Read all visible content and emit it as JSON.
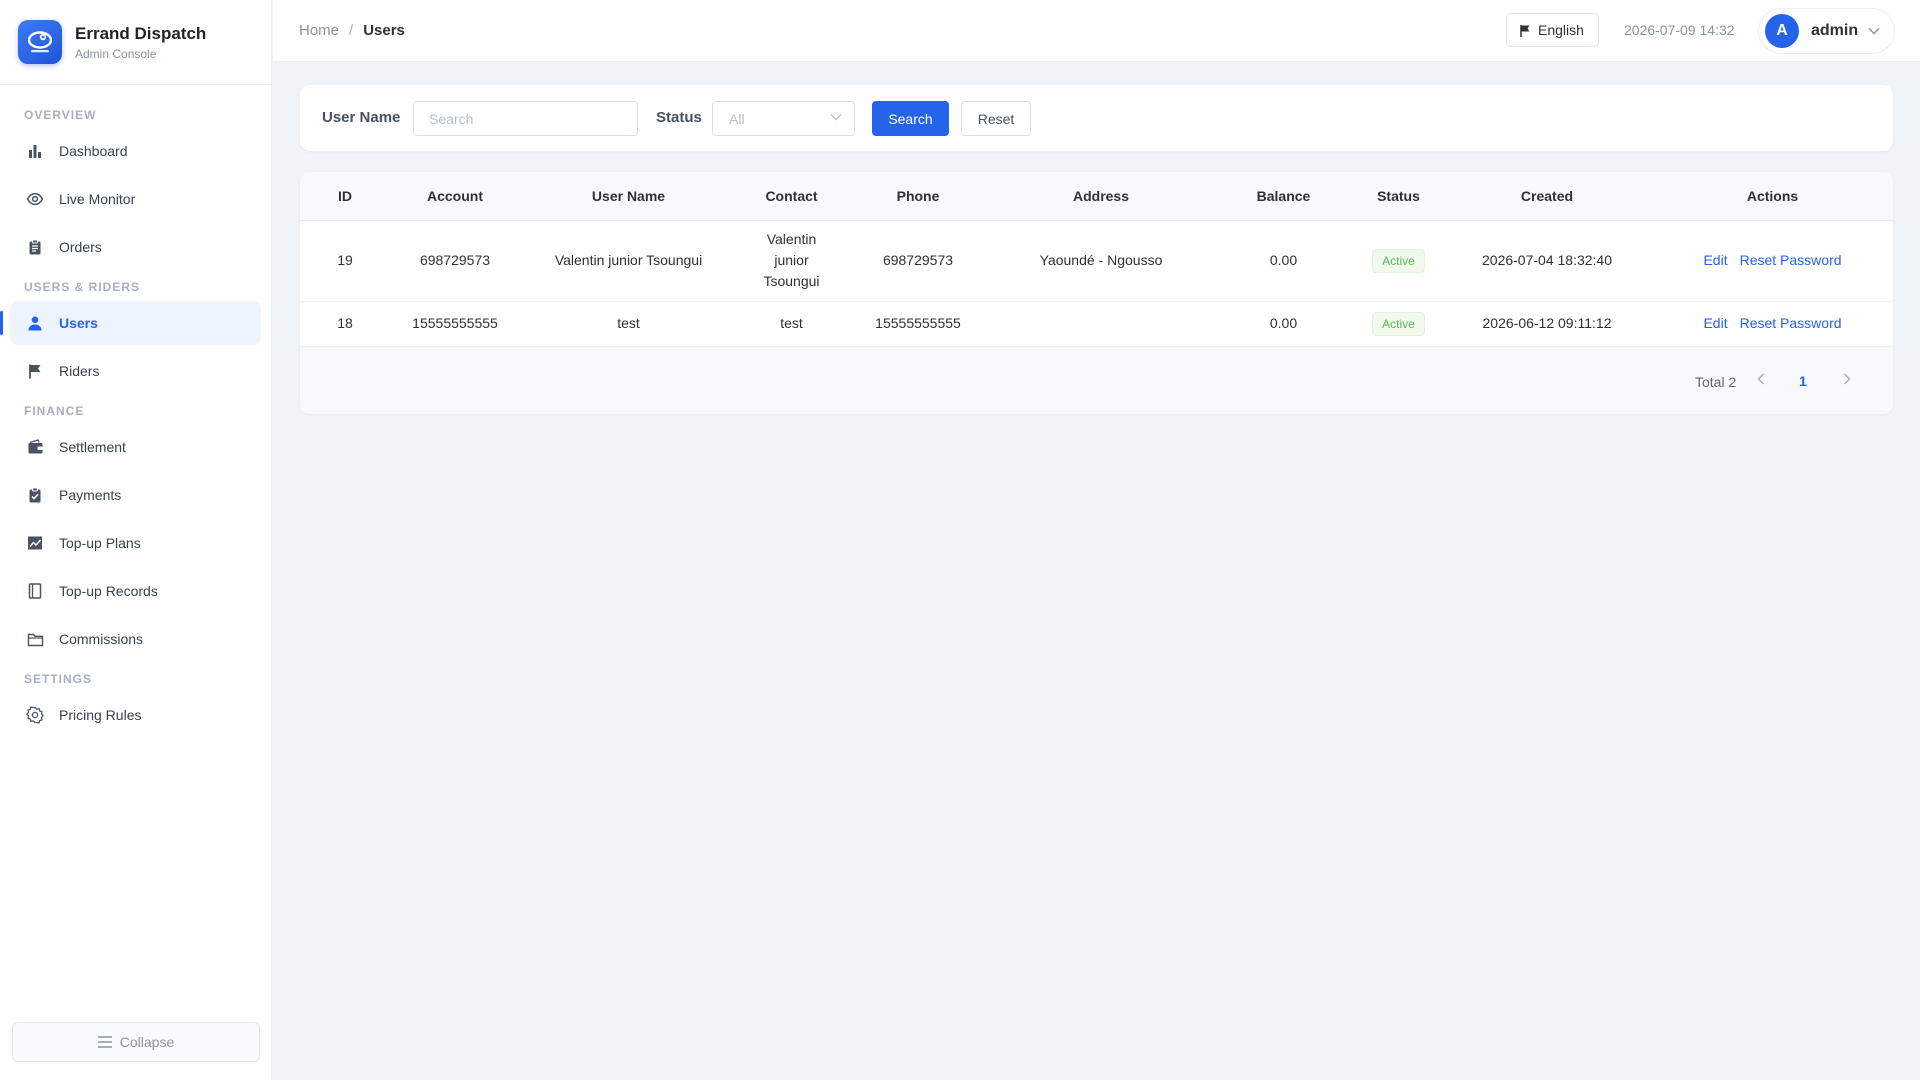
{
  "app": {
    "title": "Errand Dispatch",
    "subtitle": "Admin Console",
    "accent_color": "#2563eb"
  },
  "sidebar": {
    "groups": [
      {
        "label": "OVERVIEW",
        "items": [
          {
            "label": "Dashboard",
            "icon": "bar-chart-icon"
          },
          {
            "label": "Live Monitor",
            "icon": "eye-icon"
          },
          {
            "label": "Orders",
            "icon": "clipboard-icon"
          }
        ]
      },
      {
        "label": "USERS & RIDERS",
        "items": [
          {
            "label": "Users",
            "icon": "user-icon",
            "active": true
          },
          {
            "label": "Riders",
            "icon": "flag-icon"
          }
        ]
      },
      {
        "label": "FINANCE",
        "items": [
          {
            "label": "Settlement",
            "icon": "wallet-icon"
          },
          {
            "label": "Payments",
            "icon": "clipboard-check-icon"
          },
          {
            "label": "Top-up Plans",
            "icon": "trend-chart-icon"
          },
          {
            "label": "Top-up Records",
            "icon": "notebook-icon"
          },
          {
            "label": "Commissions",
            "icon": "folder-icon"
          }
        ]
      },
      {
        "label": "SETTINGS",
        "items": [
          {
            "label": "Pricing Rules",
            "icon": "gear-icon"
          }
        ]
      }
    ],
    "collapse_label": "Collapse"
  },
  "header": {
    "breadcrumb": [
      "Home",
      "Users"
    ],
    "breadcrumb_sep": "/",
    "language": "English",
    "datetime": "2026-07-09 14:32",
    "user": {
      "initial": "A",
      "name": "admin"
    }
  },
  "filters": {
    "username_label": "User Name",
    "username_value": "",
    "username_placeholder": "Search",
    "status_label": "Status",
    "status_selected": "All",
    "search_label": "Search",
    "reset_label": "Reset"
  },
  "table": {
    "columns": [
      "ID",
      "Account",
      "User Name",
      "Contact",
      "Phone",
      "Address",
      "Balance",
      "Status",
      "Created",
      "Actions"
    ],
    "rows": [
      {
        "id": "19",
        "account": "698729573",
        "user_name": "Valentin junior Tsoungui",
        "contact": "Valentin junior Tsoungui",
        "phone": "698729573",
        "address": "Yaoundé - Ngousso",
        "balance": "0.00",
        "status": "Active",
        "created": "2026-07-04 18:32:40",
        "actions": [
          "Edit",
          "Reset Password"
        ]
      },
      {
        "id": "18",
        "account": "15555555555",
        "user_name": "test",
        "contact": "test",
        "phone": "15555555555",
        "address": "",
        "balance": "0.00",
        "status": "Active",
        "created": "2026-06-12 09:11:12",
        "actions": [
          "Edit",
          "Reset Password"
        ]
      }
    ],
    "status_color": "#5cb85c"
  },
  "pagination": {
    "total_text": "Total 2",
    "current_page": "1"
  }
}
